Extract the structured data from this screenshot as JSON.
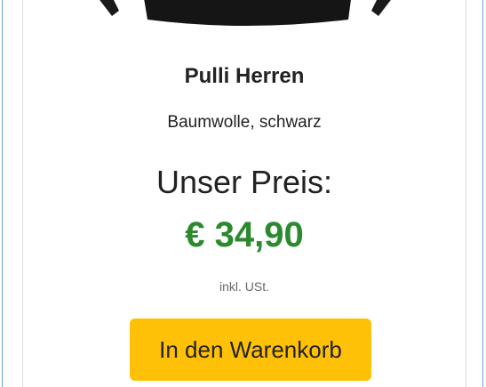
{
  "product": {
    "image_icon": "sweater-image",
    "title": "Pulli Herren",
    "description": "Baumwolle, schwarz",
    "price_label": "Unser Preis:",
    "price": "€ 34,90",
    "tax_note": "inkl. USt.",
    "price_color": "#2b8a2e"
  },
  "actions": {
    "add_to_cart_label": "In den Warenkorb",
    "button_color": "#ffc107"
  }
}
